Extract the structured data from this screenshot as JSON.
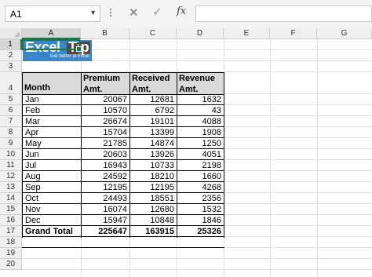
{
  "formula_bar": {
    "name_box": "A1",
    "fx_label": "fx",
    "formula": ""
  },
  "columns": [
    "A",
    "B",
    "C",
    "D",
    "E",
    "F",
    "G"
  ],
  "rows": [
    "1",
    "2",
    "3",
    "4",
    "5",
    "6",
    "7",
    "8",
    "9",
    "10",
    "11",
    "12",
    "13",
    "14",
    "15",
    "16",
    "17",
    "18",
    "19",
    "20"
  ],
  "logo": {
    "brand": "Excel",
    "brand2": "Tip",
    "tagline": "Get better at Excel"
  },
  "table": {
    "headers": {
      "month": "Month",
      "premium1": "Premium",
      "premium2": "Amt.",
      "received1": "Received",
      "received2": "Amt.",
      "revenue1": "Revenue",
      "revenue2": "Amt."
    },
    "rows": [
      [
        "Jan",
        "20067",
        "12681",
        "1632"
      ],
      [
        "Feb",
        "10570",
        "6792",
        "43"
      ],
      [
        "Mar",
        "26674",
        "19101",
        "4088"
      ],
      [
        "Apr",
        "15704",
        "13399",
        "1908"
      ],
      [
        "May",
        "21785",
        "14874",
        "1250"
      ],
      [
        "Jun",
        "20603",
        "13926",
        "4051"
      ],
      [
        "Jul",
        "16943",
        "10733",
        "2198"
      ],
      [
        "Aug",
        "24592",
        "18210",
        "1660"
      ],
      [
        "Sep",
        "12195",
        "12195",
        "4268"
      ],
      [
        "Oct",
        "24493",
        "18551",
        "2356"
      ],
      [
        "Nov",
        "16074",
        "12680",
        "1532"
      ],
      [
        "Dec",
        "15947",
        "10848",
        "1846"
      ]
    ],
    "total": [
      "Grand Total",
      "225647",
      "163915",
      "25326"
    ]
  },
  "colors": {
    "selection": "#217346",
    "header_fill": "#d9d9d9",
    "logo_blue": "#3a86cc"
  }
}
